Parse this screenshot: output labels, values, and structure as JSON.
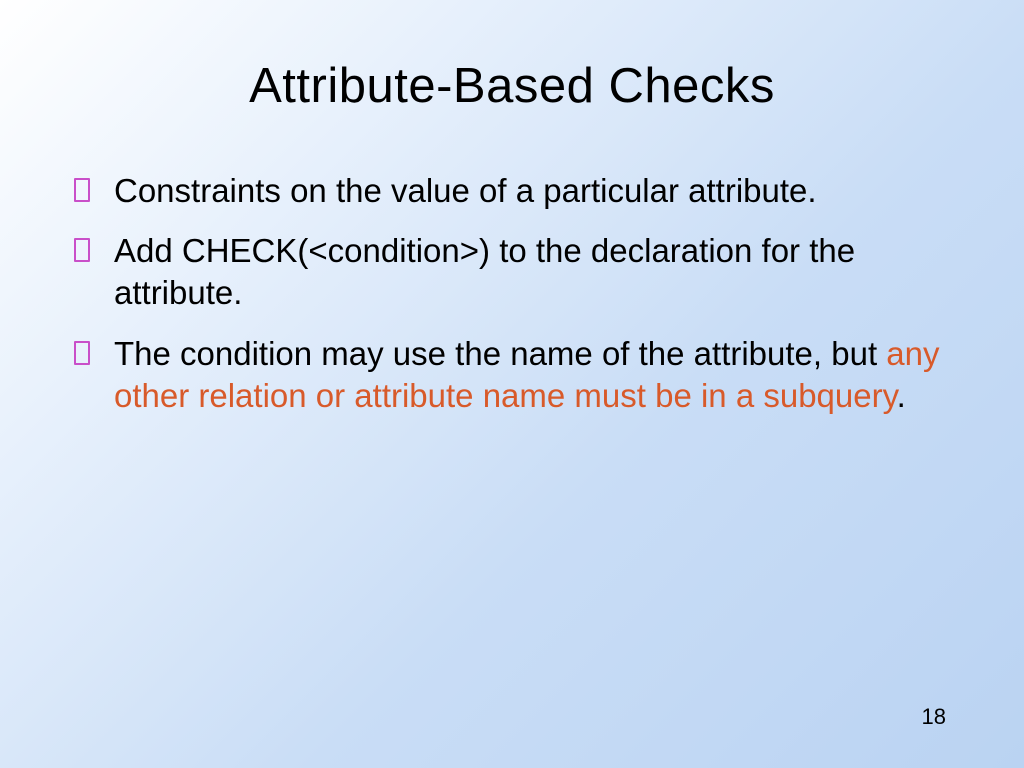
{
  "slide": {
    "title": "Attribute-Based Checks",
    "bullets": [
      {
        "text": "Constraints on the value of a particular attribute."
      },
      {
        "text": "Add CHECK(<condition>) to the declaration for the attribute."
      },
      {
        "text_prefix": "The condition may use the name of the attribute, but ",
        "highlight": "any other relation or attribute name must be in a subquery",
        "text_suffix": "."
      }
    ],
    "page_number": "18",
    "colors": {
      "bullet_marker": "#c94fc9",
      "highlight": "#d85a2a",
      "bg_start": "#ffffff",
      "bg_end": "#bad3f2"
    }
  }
}
